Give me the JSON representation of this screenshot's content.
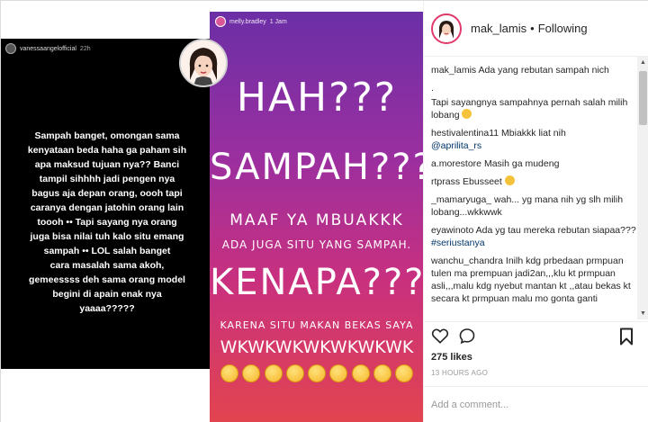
{
  "left_story": {
    "username": "vanessaangelofficial",
    "time": "22h",
    "text": "Sampah banget, omongan sama\nkenyataan beda haha ga paham sih\napa maksud tujuan nya?? Banci\ntampil sihhhh jadi pengen nya\nbagus aja depan orang, oooh tapi\ncaranya dengan jatohin orang lain\ntoooh •• Tapi sayang nya orang\njuga bisa nilai tuh kalo situ emang\nsampah •• LOL salah banget\ncara masalah sama akoh,\ngemeessss deh sama orang model\nbegini di apain enak nya\nyaaaa?????"
  },
  "right_story": {
    "username": "melly.bradley",
    "time": "1 Jam",
    "line1": "HAH???",
    "line2": "SAMPAH???",
    "line3": "MAAF YA MBUAKKK",
    "line4": "ADA JUGA SITU YANG SAMPAH.",
    "line5": "KENAPA???",
    "line6": "KARENA SITU MAKAN BEKAS SAYA",
    "line7": "WKWKWKWKWKWKWK"
  },
  "header": {
    "username": "mak_lamis",
    "separator": "•",
    "follow_status": "Following"
  },
  "comments": [
    {
      "user": "mak_lamis",
      "text": "Ada yang rebutan sampah nich"
    },
    {
      "user": "",
      "text": "."
    },
    {
      "user": "",
      "text": "Tapi sayangnya sampahnya pernah salah milih lobang"
    },
    {
      "user": "hestivalentina11",
      "text": "Mbiakkk liat nih",
      "tag": "@aprilita_rs"
    },
    {
      "user": "a.morestore",
      "text": "Masih ga mudeng"
    },
    {
      "user": "rtprass",
      "text": "Ebusseet"
    },
    {
      "user": "_mamaryuga_",
      "text": "wah... yg mana nih yg slh milih lobang...wkkwwk"
    },
    {
      "user": "eyawinoto",
      "text": "Ada yg tau mereka rebutan siapaa???",
      "tag": "#seriustanya"
    },
    {
      "user": "wanchu_chandra",
      "text": "Inilh kdg prbedaan prmpuan tulen ma prempuan jadi2an,,,klu kt prmpuan asli,,,malu kdg nyebut mantan kt ,,atau bekas kt secara kt prmpuan malu mo gonta ganti"
    }
  ],
  "likes": "275 likes",
  "time_ago": "13 HOURS AGO",
  "comment_input": {
    "placeholder": "Add a comment..."
  }
}
